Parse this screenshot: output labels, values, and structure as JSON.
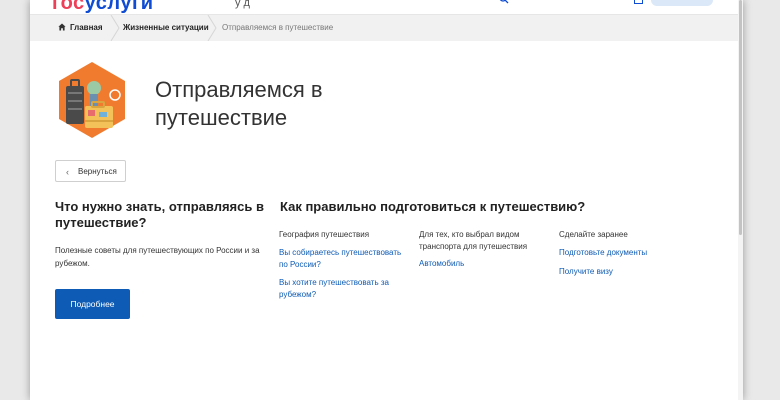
{
  "header": {
    "logo_gos": "гос",
    "logo_usl": "услуги",
    "nav_fragment": "у   д"
  },
  "breadcrumb": {
    "home": "Главная",
    "level2": "Жизненные ситуации",
    "current": "Отправляемся в путешествие"
  },
  "page": {
    "title_line1": "Отправляемся в",
    "title_line2": "путешествие",
    "back_label": "Вернуться"
  },
  "left": {
    "title": "Что нужно знать, отправляясь в путешествие?",
    "description": "Полезные советы для путешествующих по России и за рубежом.",
    "button_label": "Подробнее"
  },
  "right": {
    "title": "Как правильно подготовиться к путешествию?",
    "columns": [
      {
        "heading": "География путешествия",
        "links": [
          "Вы собираетесь путешествовать по России?",
          "Вы хотите путешествовать за рубежом?"
        ]
      },
      {
        "heading": "Для тех, кто выбрал видом транспорта для путешествия",
        "links": [
          "Автомобиль"
        ]
      },
      {
        "heading": "Сделайте заранее",
        "links": [
          "Подготовьте документы",
          "Получите визу"
        ]
      }
    ]
  },
  "colors": {
    "accent": "#0d5bb5",
    "logo_red": "#ee3f58",
    "logo_blue": "#0d4cd3",
    "icon_orange": "#f07b2e"
  },
  "icons": {
    "home": "home-icon",
    "back": "chevron-left-icon",
    "hero": "travel-luggage-icon"
  }
}
